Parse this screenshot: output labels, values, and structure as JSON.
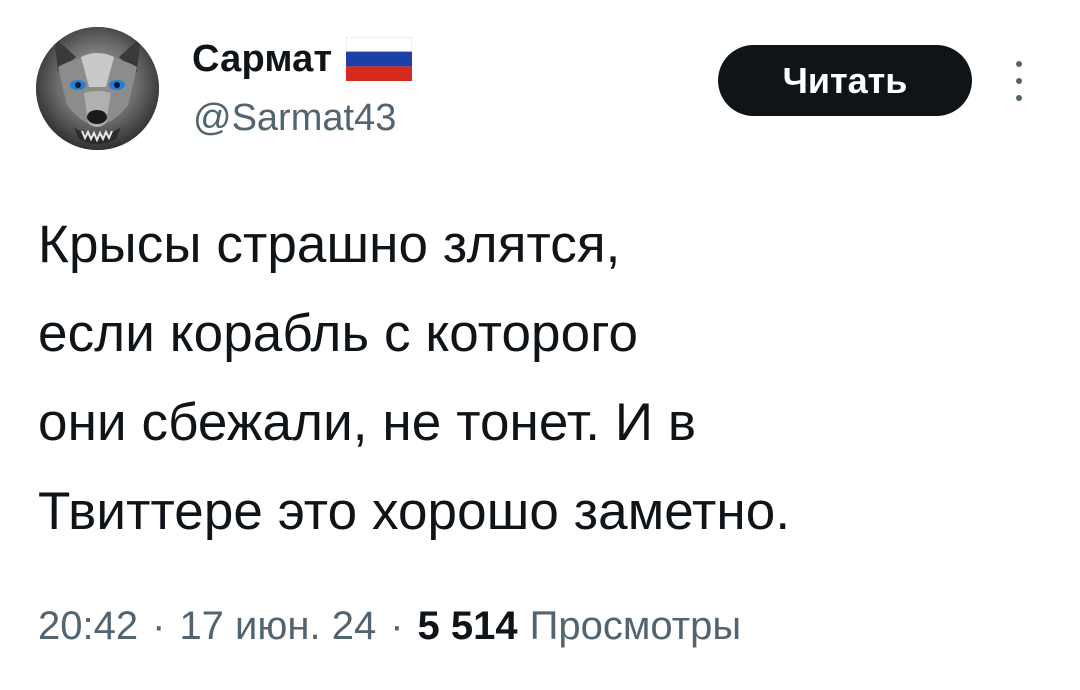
{
  "tweet": {
    "author": {
      "display_name": "Сармат",
      "handle": "@Sarmat43",
      "flag_icon": "russian-flag-icon",
      "avatar_icon": "wolf-avatar"
    },
    "follow_label": "Читать",
    "more_icon": "more-vertical-icon",
    "text": "Крысы страшно злятся,\nесли корабль с которого\nони сбежали, не тонет. И в\nТвиттере это хорошо заметно.",
    "time": "20:42",
    "date": "17 июн. 24",
    "separator": "·",
    "views_count": "5 514",
    "views_label": "Просмотры"
  },
  "colors": {
    "text_primary": "#0f1419",
    "text_secondary": "#536471",
    "button_bg": "#0f1419",
    "button_text": "#ffffff",
    "flag_white": "#ffffff",
    "flag_blue": "#1c3fa8",
    "flag_red": "#d52b1e"
  }
}
